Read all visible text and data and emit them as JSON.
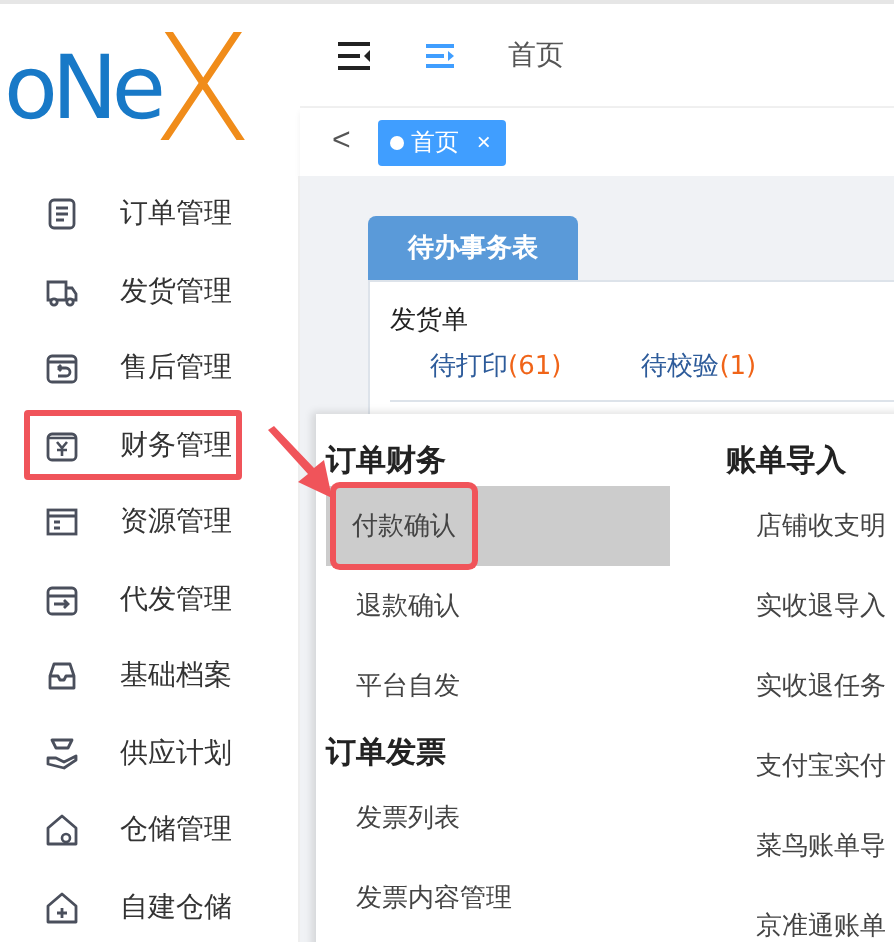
{
  "logo": {
    "text": "oNe",
    "mark": "X"
  },
  "header": {
    "breadcrumb": "首页"
  },
  "tabs_bar": {
    "back": "<",
    "tabs": [
      {
        "label": "首页",
        "close": "×",
        "selected": true
      }
    ]
  },
  "sidebar": {
    "items": [
      {
        "label": "订单管理",
        "highlighted": false
      },
      {
        "label": "发货管理",
        "highlighted": false
      },
      {
        "label": "售后管理",
        "highlighted": false
      },
      {
        "label": "财务管理",
        "highlighted": true
      },
      {
        "label": "资源管理",
        "highlighted": false
      },
      {
        "label": "代发管理",
        "highlighted": false
      },
      {
        "label": "基础档案",
        "highlighted": false
      },
      {
        "label": "供应计划",
        "highlighted": false
      },
      {
        "label": "仓储管理",
        "highlighted": false
      },
      {
        "label": "自建仓储",
        "highlighted": false
      }
    ]
  },
  "todo_card": {
    "tab": "待办事务表",
    "section": "发货单",
    "links": [
      {
        "label": "待打印",
        "count": "(61)"
      },
      {
        "label": "待校验",
        "count": "(1)"
      }
    ]
  },
  "flyout": {
    "columns": [
      {
        "groups": [
          {
            "title": "订单财务",
            "items": [
              {
                "label": "付款确认",
                "selected": true,
                "highlighted": true
              },
              {
                "label": "退款确认",
                "selected": false,
                "highlighted": false
              },
              {
                "label": "平台自发",
                "selected": false,
                "highlighted": false
              }
            ]
          },
          {
            "title": "订单发票",
            "items": [
              {
                "label": "发票列表",
                "selected": false,
                "highlighted": false
              },
              {
                "label": "发票内容管理",
                "selected": false,
                "highlighted": false
              }
            ]
          }
        ]
      },
      {
        "groups": [
          {
            "title": "账单导入",
            "items": [
              {
                "label": "店铺收支明",
                "selected": false,
                "highlighted": false
              },
              {
                "label": "实收退导入",
                "selected": false,
                "highlighted": false
              },
              {
                "label": "实收退任务",
                "selected": false,
                "highlighted": false
              },
              {
                "label": "支付宝实付",
                "selected": false,
                "highlighted": false
              },
              {
                "label": "菜鸟账单导",
                "selected": false,
                "highlighted": false
              },
              {
                "label": "京准通账单",
                "selected": false,
                "highlighted": false
              }
            ]
          }
        ]
      }
    ]
  }
}
